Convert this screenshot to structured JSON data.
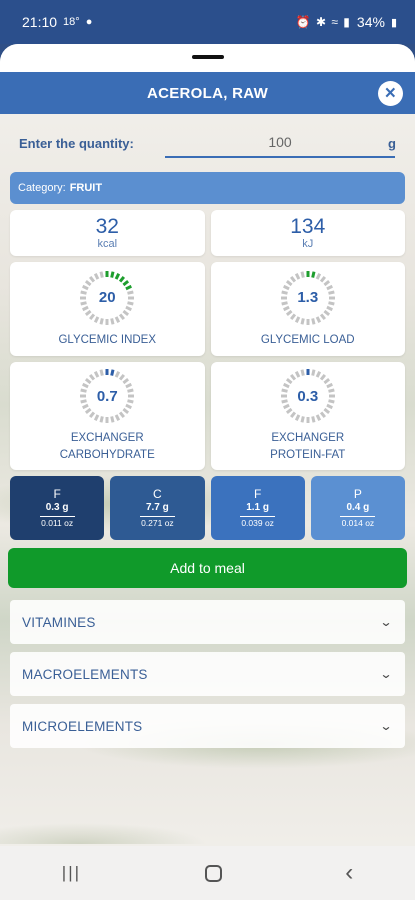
{
  "status_bar": {
    "time": "21:10",
    "temperature": "18°",
    "battery": "34%",
    "icons": [
      "android-bug-icon",
      "alarm-icon",
      "bluetooth-icon",
      "wifi-icon",
      "signal-icon",
      "battery-icon"
    ]
  },
  "dialog": {
    "title": "ACEROLA, RAW",
    "close_icon": "close-icon"
  },
  "quantity": {
    "label": "Enter the quantity:",
    "value": "100",
    "unit": "g"
  },
  "category": {
    "label": "Category:",
    "value": "FRUIT"
  },
  "energy": {
    "kcal_value": "32",
    "kcal_unit": "kcal",
    "kj_value": "134",
    "kj_unit": "kJ"
  },
  "gauges": {
    "glycemic_index": {
      "value": "20",
      "label": "GLYCEMIC INDEX",
      "fill_fraction": 0.2,
      "color": "#1e9e2e"
    },
    "glycemic_load": {
      "value": "1.3",
      "label": "GLYCEMIC LOAD",
      "fill_fraction": 0.08,
      "color": "#1e9e2e"
    },
    "exchanger_carbohydrate": {
      "value": "0.7",
      "label_line1": "EXCHANGER",
      "label_line2": "CARBOHYDRATE",
      "fill_fraction": 0.07,
      "color": "#2d5ea8"
    },
    "exchanger_protein_fat": {
      "value": "0.3",
      "label_line1": "EXCHANGER",
      "label_line2": "PROTEIN-FAT",
      "fill_fraction": 0.04,
      "color": "#2d5ea8"
    }
  },
  "macros": [
    {
      "letter": "F",
      "grams": "0.3 g",
      "oz": "0.011 oz",
      "color": "#1f3f6e"
    },
    {
      "letter": "C",
      "grams": "7.7 g",
      "oz": "0.271 oz",
      "color": "#2e5a93"
    },
    {
      "letter": "F",
      "grams": "1.1 g",
      "oz": "0.039 oz",
      "color": "#3b72be"
    },
    {
      "letter": "P",
      "grams": "0.4 g",
      "oz": "0.014 oz",
      "color": "#5b90d2"
    }
  ],
  "add_button": {
    "label": "Add to meal",
    "color": "#109a2a"
  },
  "sections": [
    {
      "label": "VITAMINES"
    },
    {
      "label": "MACROELEMENTS"
    },
    {
      "label": "MICROELEMENTS"
    }
  ],
  "colors": {
    "primary": "#3a6db5",
    "status_bar": "#2b4f8c"
  }
}
